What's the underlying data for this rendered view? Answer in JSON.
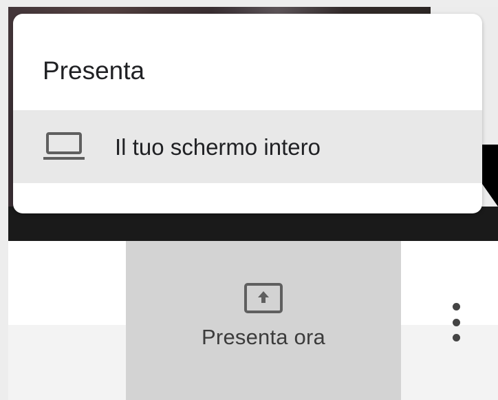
{
  "menu": {
    "title": "Presenta",
    "items": [
      {
        "label": "Il tuo schermo intero",
        "icon": "laptop-icon"
      }
    ]
  },
  "toolbar": {
    "present_now_label": "Presenta ora",
    "present_now_icon": "present-to-all-icon",
    "more_icon": "more-vert-icon"
  },
  "colors": {
    "menu_bg": "#ffffff",
    "menu_item_highlight": "#e8e8e8",
    "present_button_bg": "#d3d3d3",
    "text_primary": "#202124"
  }
}
